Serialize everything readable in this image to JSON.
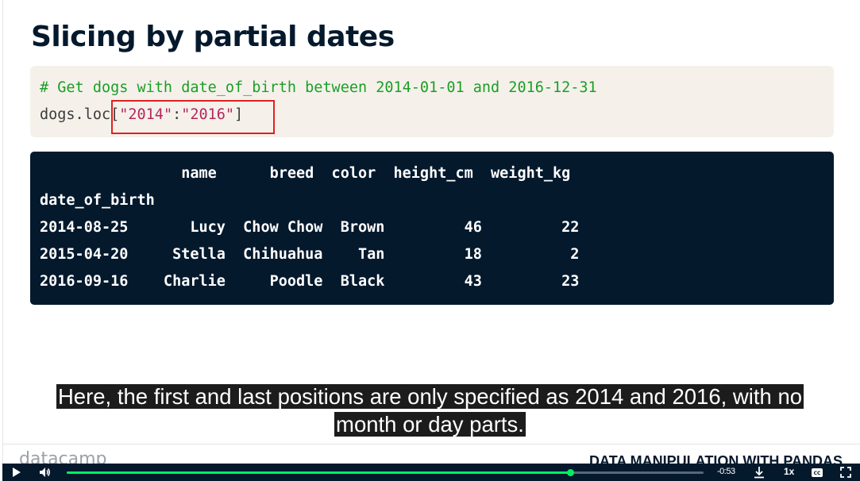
{
  "slide": {
    "title": "Slicing by partial dates",
    "code": {
      "comment": "# Get dogs with date_of_birth between 2014-01-01 and 2016-12-31",
      "prefix": "dogs.loc[",
      "str1": "\"2014\"",
      "colon": ":",
      "str2": "\"2016\"",
      "suffix": "]"
    },
    "output": {
      "header": "                name      breed  color  height_cm  weight_kg",
      "index_label": "date_of_birth",
      "rows": [
        "2014-08-25       Lucy  Chow Chow  Brown         46         22",
        "2015-04-20     Stella  Chihuahua    Tan         18          2",
        "2016-09-16    Charlie     Poodle  Black         43         23"
      ]
    },
    "footer": {
      "logo": "datacamp",
      "course": "DATA MANIPULATION WITH PANDAS"
    }
  },
  "subtitles": {
    "line1": "Here, the first and last positions are only specified as 2014 and 2016, with no",
    "line2": "month or day parts."
  },
  "player": {
    "time_remaining": "-0:53",
    "speed": "1x",
    "progress": 0.79,
    "icons": {
      "play": "play-icon",
      "volume": "volume-icon",
      "download": "download-icon",
      "captions": "captions-icon",
      "fullscreen": "fullscreen-icon"
    },
    "accent_color": "#03ef62"
  }
}
